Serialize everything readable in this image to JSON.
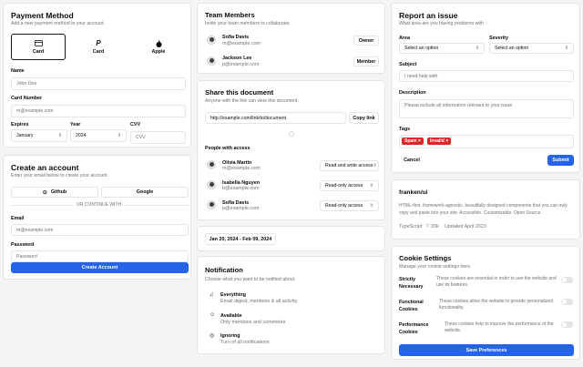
{
  "payment": {
    "title": "Payment Method",
    "subtitle": "Add a new payment method to your account.",
    "methods": [
      "Card",
      "Card",
      "Apple"
    ],
    "name_label": "Name",
    "name_value": "John Doe",
    "card_label": "Card Number",
    "card_placeholder": "m@example.com",
    "expires_label": "Expires",
    "expires_value": "January",
    "year_label": "Year",
    "year_value": "2024",
    "cvv_label": "CVV",
    "cvv_placeholder": "CVV"
  },
  "account": {
    "title": "Create an account",
    "subtitle": "Enter your email below to create your account",
    "github": "Github",
    "google": "Google",
    "divider": "OR CONTINUE WITH",
    "email_label": "Email",
    "email_placeholder": "m@example.com",
    "password_label": "Password",
    "password_placeholder": "Password",
    "submit": "Create Account"
  },
  "team": {
    "title": "Team Members",
    "subtitle": "Invite your team members to collaborate.",
    "members": [
      {
        "name": "Sofia Davis",
        "email": "m@example.com",
        "role": "Owner"
      },
      {
        "name": "Jackson Lee",
        "email": "p@example.com",
        "role": "Member"
      }
    ]
  },
  "share": {
    "title": "Share this document",
    "subtitle": "Anyone with the link can view this document.",
    "link": "http://example.com/link/to/document",
    "copy": "Copy link",
    "people_label": "People with access",
    "people": [
      {
        "name": "Olivia Martin",
        "email": "m@example.com",
        "access": "Read and write access"
      },
      {
        "name": "Isabella Nguyen",
        "email": "b@example.com",
        "access": "Read-only access"
      },
      {
        "name": "Sofia Davis",
        "email": "p@example.com",
        "access": "Read-only access"
      }
    ]
  },
  "date": {
    "range": "Jan 20, 2024 - Feb 09, 2024"
  },
  "notification": {
    "title": "Notification",
    "subtitle": "Choose what you want to be notified about.",
    "options": [
      {
        "title": "Everything",
        "desc": "Email digest, mentions & all activity."
      },
      {
        "title": "Available",
        "desc": "Only mentions and comments"
      },
      {
        "title": "Ignoring",
        "desc": "Turn of all notifications"
      }
    ]
  },
  "issue": {
    "title": "Report an issue",
    "subtitle": "What area are you having problems with",
    "area_label": "Area",
    "area_value": "Select an option",
    "severity_label": "Severity",
    "severity_value": "Select an option",
    "subject_label": "Subject",
    "subject_placeholder": "I need help with",
    "desc_label": "Description",
    "desc_placeholder": "Please include all information relevant to your issue",
    "tags_label": "Tags",
    "tags": [
      "Spam",
      "Invalid"
    ],
    "cancel": "Cancel",
    "submit": "Submit"
  },
  "repo": {
    "title": "franken/ui",
    "desc": "HTML-first, framework-agnostic, beautifully designed components that you can truly copy and paste into your site. Accessible. Customizable. Open Source.",
    "language": "TypeScript",
    "stars": "20k",
    "updated": "Updated April 2023"
  },
  "cookies": {
    "title": "Cookie Settings",
    "subtitle": "Manage your cookie settings here.",
    "items": [
      {
        "label": "Strictly Necessary",
        "desc": "These cookies are essential in order to use the website and use its features."
      },
      {
        "label": "Functional Cookies",
        "desc": "These cookies allow the website to provide personalized functionality."
      },
      {
        "label": "Performance Cookies",
        "desc": "These cookies help to improve the performance of the website."
      }
    ],
    "save": "Save Preferences"
  },
  "colors": {
    "primary": "#2563eb",
    "danger": "#dc2626"
  }
}
